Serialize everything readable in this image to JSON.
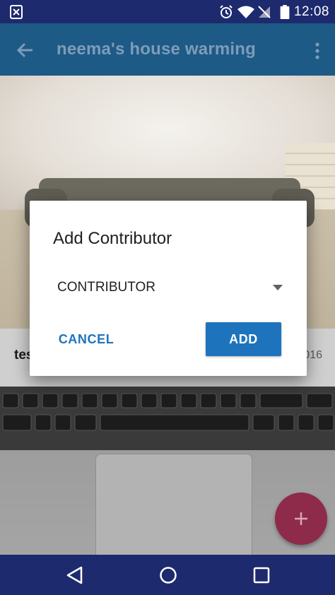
{
  "status_bar": {
    "time": "12:08",
    "icons": [
      "notification-icon",
      "alarm-icon",
      "wifi-icon",
      "no-signal-icon",
      "battery-icon"
    ]
  },
  "app_bar": {
    "title": "neema's house warming",
    "back_icon": "arrow-back-icon",
    "more_icon": "more-vert-icon"
  },
  "feed": {
    "item1_name": "tes",
    "item1_date": "016"
  },
  "dialog": {
    "title": "Add Contributor",
    "role_select_value": "CONTRIBUTOR",
    "cancel_label": "CANCEL",
    "add_label": "ADD"
  },
  "fab": {
    "icon": "plus-icon"
  },
  "nav_bar": {
    "icons": [
      "back-triangle-icon",
      "home-circle-icon",
      "recents-square-icon"
    ]
  },
  "colors": {
    "status_bar": "#1e2a6e",
    "app_bar": "#1d5a86",
    "accent_blue": "#1d74bc",
    "fab": "#8e2a4a"
  }
}
